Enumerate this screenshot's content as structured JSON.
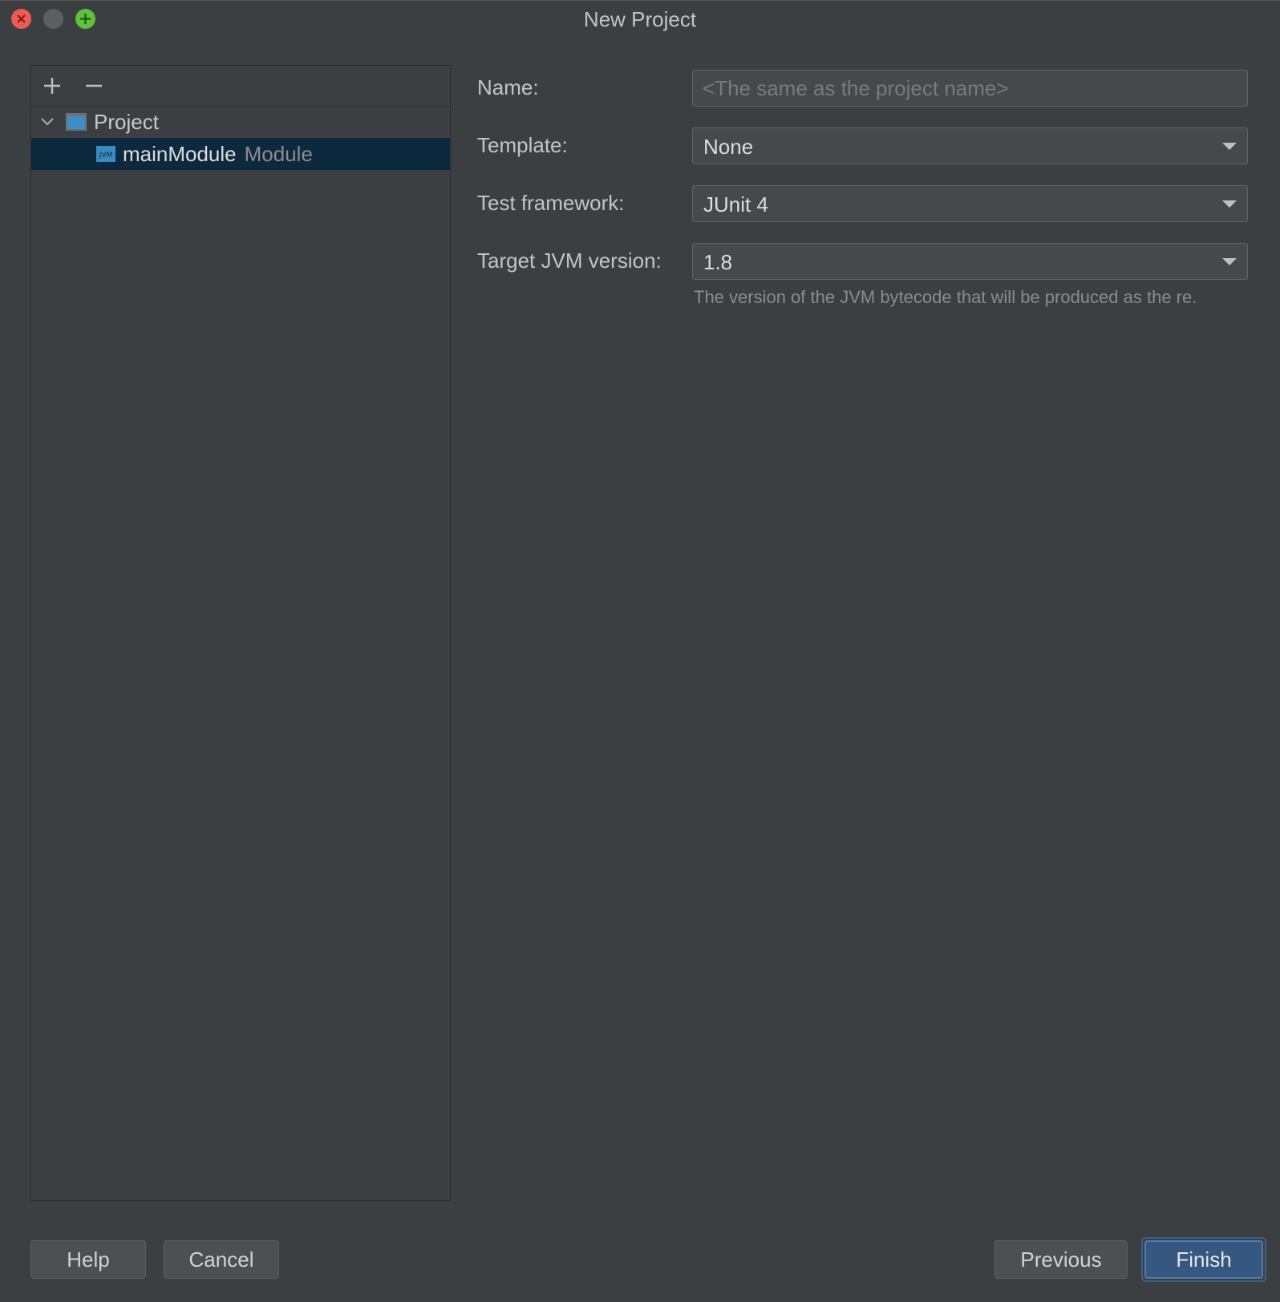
{
  "window": {
    "title": "New Project"
  },
  "tree": {
    "items": [
      {
        "label": "Project",
        "icon": "project-folder-icon",
        "expanded": true
      },
      {
        "label": "mainModule",
        "type": "Module",
        "icon": "jvm-module-icon",
        "selected": true
      }
    ]
  },
  "form": {
    "name": {
      "label": "Name:",
      "value": "",
      "placeholder": "<The same as the project name>"
    },
    "template": {
      "label": "Template:",
      "value": "None"
    },
    "test_framework": {
      "label": "Test framework:",
      "value": "JUnit 4"
    },
    "jvm_version": {
      "label": "Target JVM version:",
      "value": "1.8",
      "hint": "The version of the JVM bytecode that will be produced as the re."
    }
  },
  "buttons": {
    "help": "Help",
    "cancel": "Cancel",
    "previous": "Previous",
    "finish": "Finish"
  },
  "colors": {
    "background": "#3c3f41",
    "selection": "#0d293e",
    "primary_button": "#365880"
  }
}
